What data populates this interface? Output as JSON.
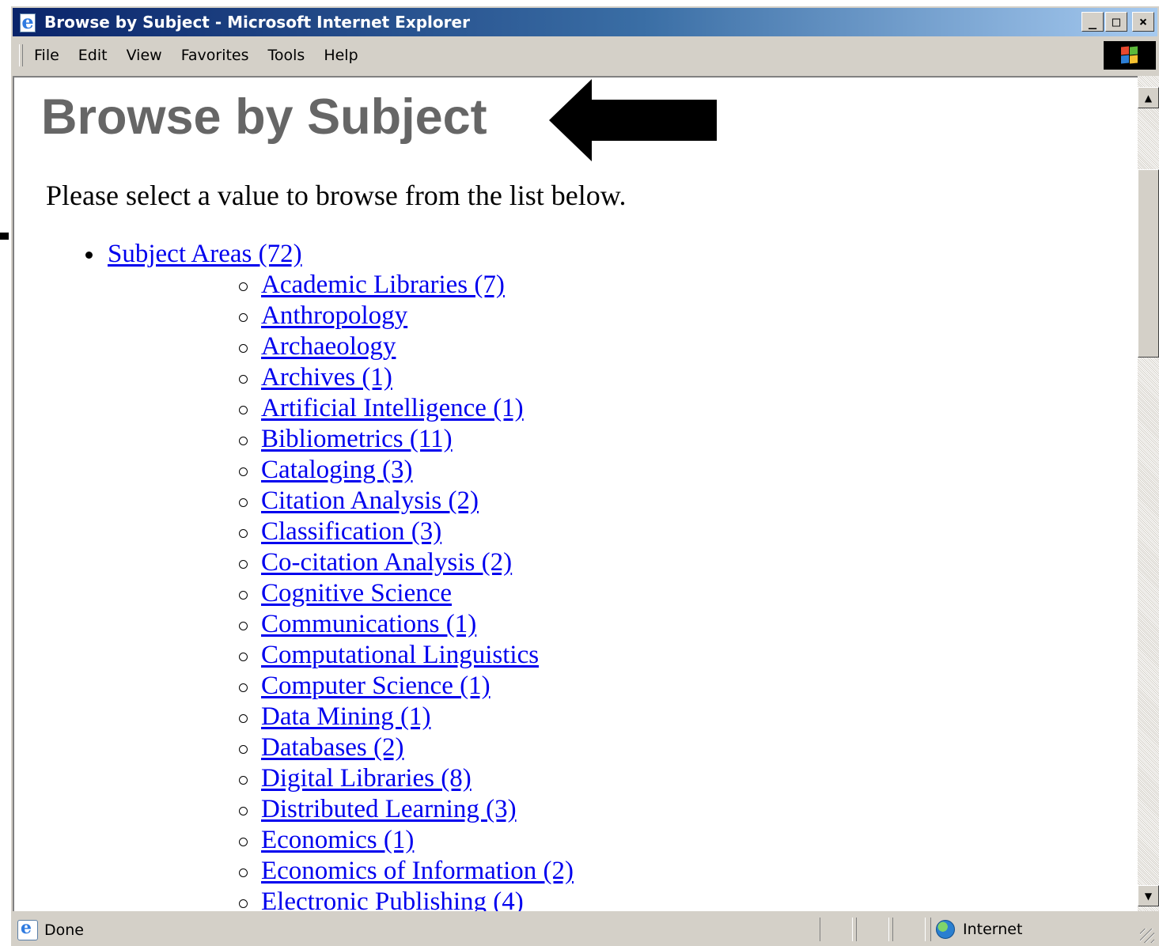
{
  "window": {
    "title": "Browse by Subject - Microsoft Internet Explorer",
    "buttons": {
      "minimize": "_",
      "maximize": "□",
      "close": "×"
    }
  },
  "menu": [
    {
      "label": "File"
    },
    {
      "label": "Edit"
    },
    {
      "label": "View"
    },
    {
      "label": "Favorites"
    },
    {
      "label": "Tools"
    },
    {
      "label": "Help"
    }
  ],
  "page": {
    "title": "Browse by Subject",
    "intro": "Please select a value to browse from the list below.",
    "category": "Subject Areas (72)",
    "subjects": [
      "Academic Libraries (7)",
      "Anthropology",
      "Archaeology",
      "Archives (1)",
      "Artificial Intelligence (1)",
      "Bibliometrics (11)",
      "Cataloging (3)",
      "Citation Analysis (2)",
      "Classification (3)",
      "Co-citation Analysis (2)",
      "Cognitive Science",
      "Communications (1)",
      "Computational Linguistics",
      "Computer Science (1)",
      "Data Mining (1)",
      "Databases (2)",
      "Digital Libraries (8)",
      "Distributed Learning (3)",
      "Economics (1)",
      "Economics of Information (2)",
      "Electronic Publishing (4)"
    ]
  },
  "status": {
    "text": "Done",
    "zone": "Internet"
  },
  "colors": {
    "link": "#0000ee",
    "title_gray": "#666666",
    "chrome": "#d4d0c8",
    "titlebar_start": "#0a246a",
    "titlebar_end": "#a6caf0"
  }
}
